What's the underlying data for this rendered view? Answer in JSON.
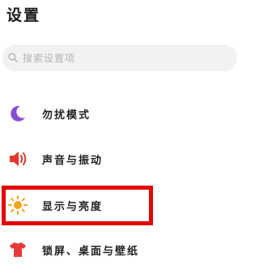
{
  "header": {
    "title": "设置"
  },
  "search": {
    "placeholder": "搜索设置项",
    "icon": "search-icon"
  },
  "items": [
    {
      "label": "勿扰模式",
      "icon": "moon-icon",
      "color": "#8a4fd0"
    },
    {
      "label": "声音与振动",
      "icon": "speaker-icon",
      "color": "#e23a2e"
    },
    {
      "label": "显示与亮度",
      "icon": "sun-icon",
      "color": "#f5a31a",
      "highlighted": true
    },
    {
      "label": "锁屏、桌面与壁纸",
      "icon": "tshirt-icon",
      "color": "#e63a3a"
    }
  ],
  "highlight_color": "#e30000"
}
